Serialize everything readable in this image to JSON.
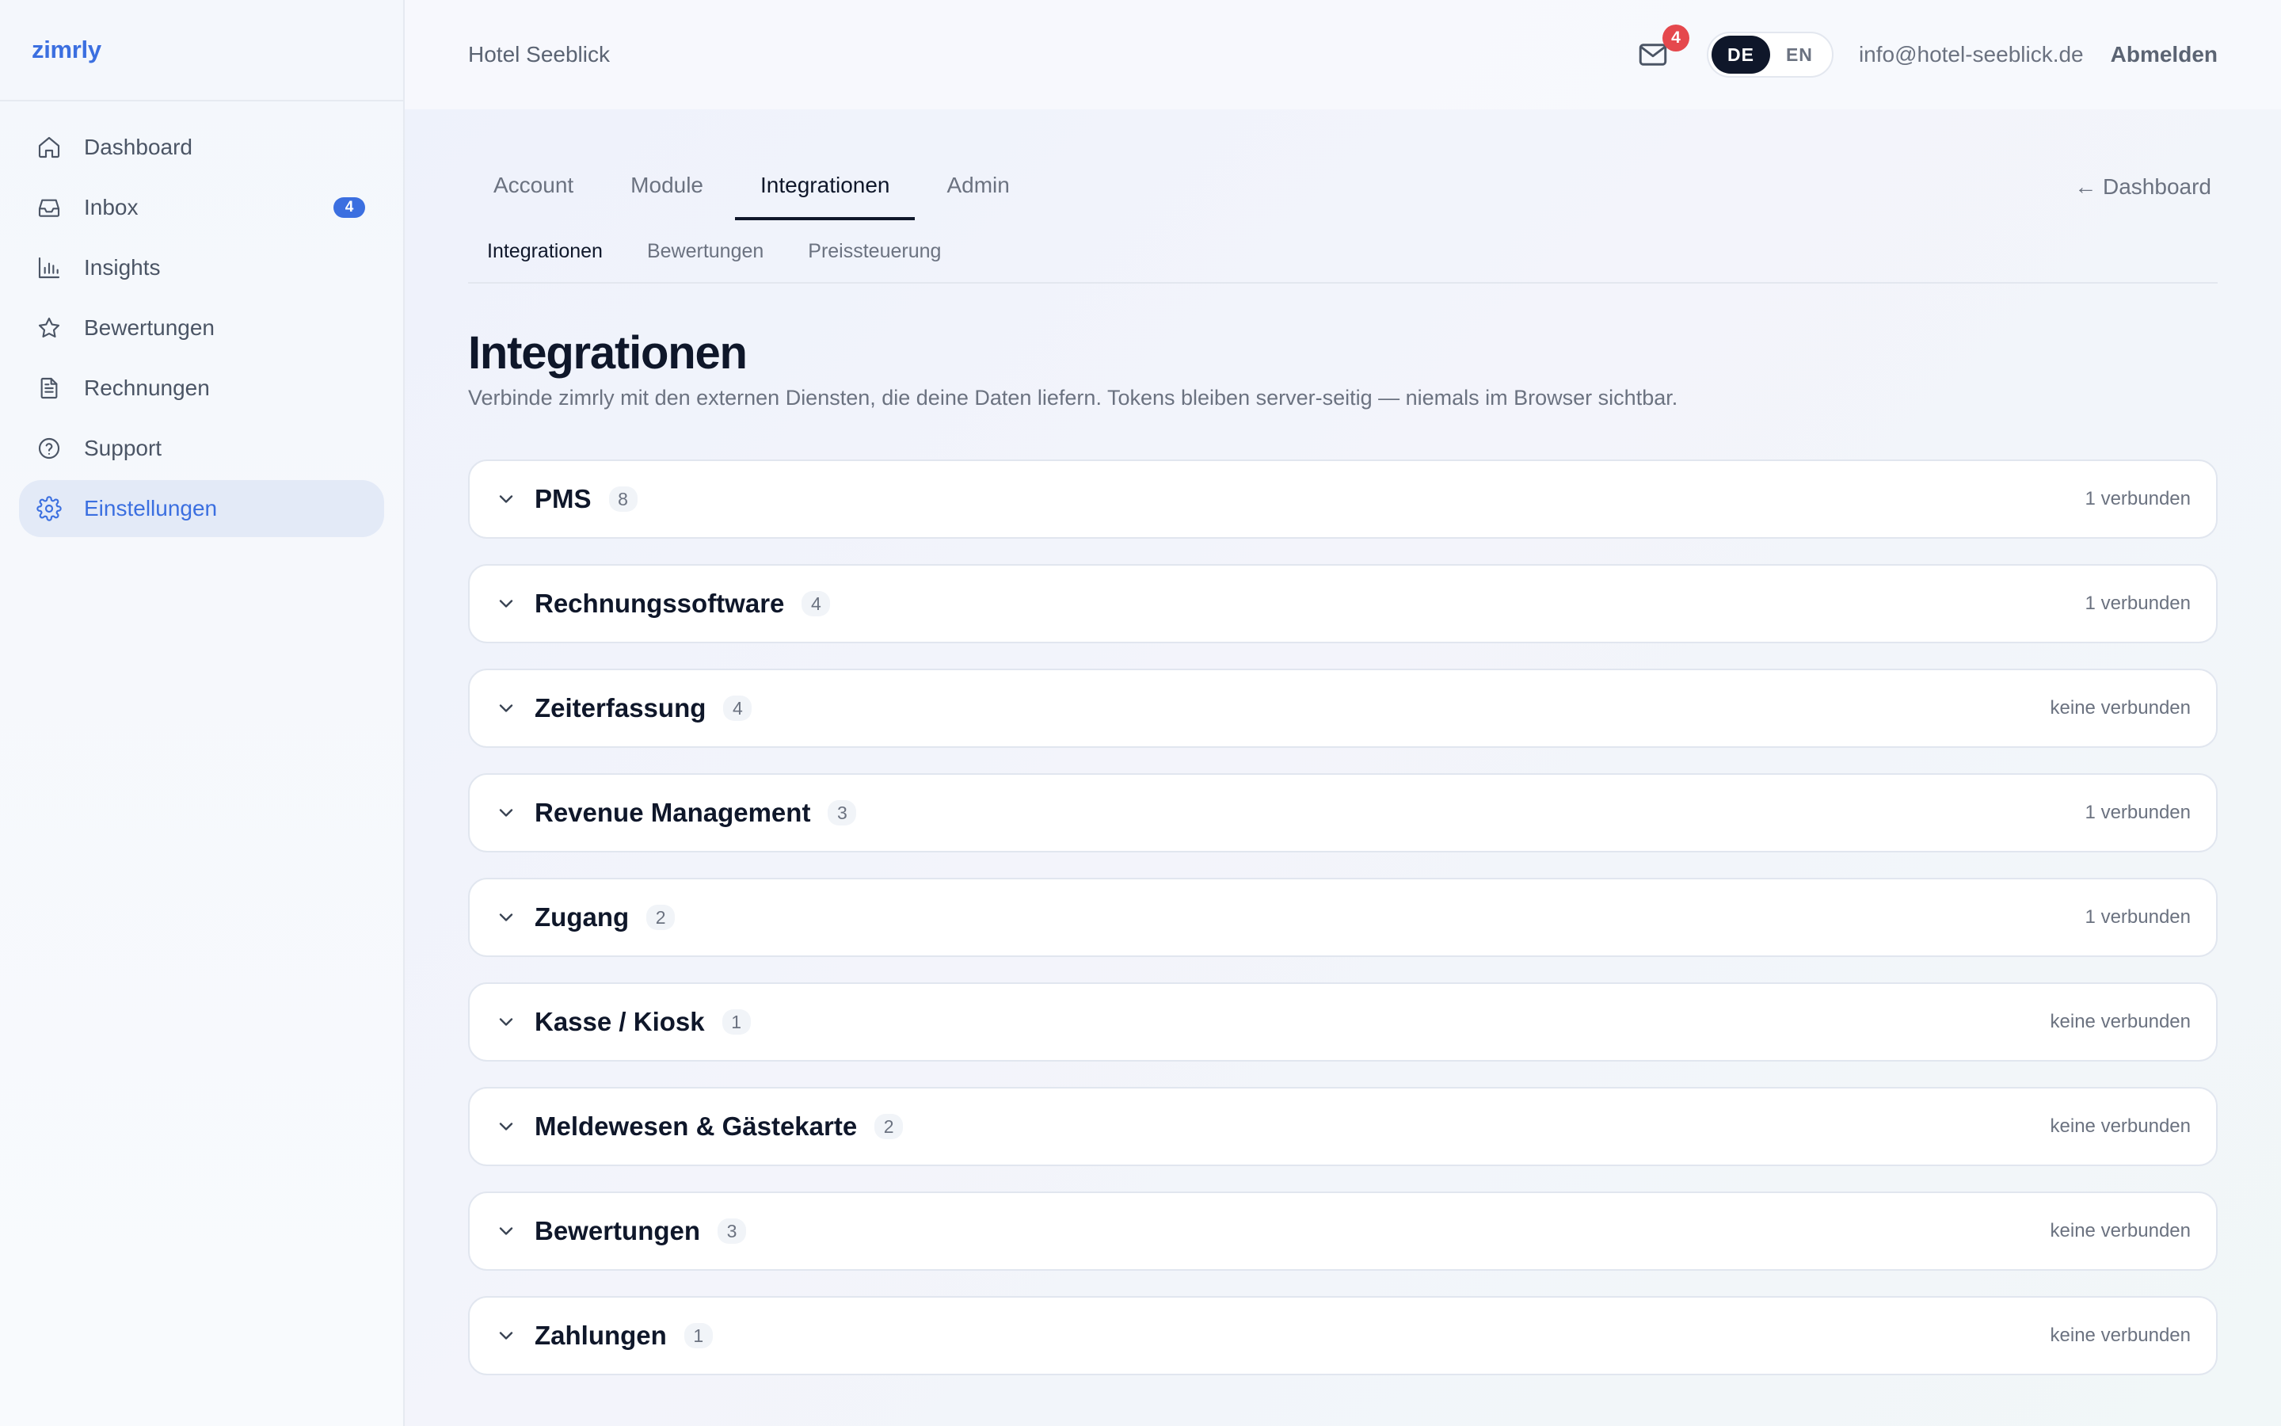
{
  "brand": "zimrly",
  "sidebar": {
    "items": [
      {
        "label": "Dashboard",
        "icon": "home-icon"
      },
      {
        "label": "Inbox",
        "icon": "inbox-icon",
        "badge": "4"
      },
      {
        "label": "Insights",
        "icon": "bar-chart-icon"
      },
      {
        "label": "Bewertungen",
        "icon": "star-icon"
      },
      {
        "label": "Rechnungen",
        "icon": "document-icon"
      },
      {
        "label": "Support",
        "icon": "help-circle-icon"
      },
      {
        "label": "Einstellungen",
        "icon": "gear-icon",
        "active": true
      }
    ]
  },
  "header": {
    "hotel": "Hotel Seeblick",
    "mail_badge": "4",
    "lang_de": "DE",
    "lang_en": "EN",
    "active_lang": "DE",
    "email": "info@hotel-seeblick.de",
    "logout": "Abmelden"
  },
  "tabs": {
    "items": [
      "Account",
      "Module",
      "Integrationen",
      "Admin"
    ],
    "active": "Integrationen",
    "back": "← Dashboard"
  },
  "subtabs": {
    "items": [
      "Integrationen",
      "Bewertungen",
      "Preissteuerung"
    ],
    "active": "Integrationen"
  },
  "page": {
    "title": "Integrationen",
    "description": "Verbinde zimrly mit den externen Diensten, die deine Daten liefern. Tokens bleiben server-seitig — niemals im Browser sichtbar."
  },
  "groups": [
    {
      "name": "PMS",
      "count": "8",
      "status": "1 verbunden"
    },
    {
      "name": "Rechnungssoftware",
      "count": "4",
      "status": "1 verbunden"
    },
    {
      "name": "Zeiterfassung",
      "count": "4",
      "status": "keine verbunden"
    },
    {
      "name": "Revenue Management",
      "count": "3",
      "status": "1 verbunden"
    },
    {
      "name": "Zugang",
      "count": "2",
      "status": "1 verbunden"
    },
    {
      "name": "Kasse / Kiosk",
      "count": "1",
      "status": "keine verbunden"
    },
    {
      "name": "Meldewesen & Gästekarte",
      "count": "2",
      "status": "keine verbunden"
    },
    {
      "name": "Bewertungen",
      "count": "3",
      "status": "keine verbunden"
    },
    {
      "name": "Zahlungen",
      "count": "1",
      "status": "keine verbunden"
    }
  ],
  "colors": {
    "accent": "#3b6fe0",
    "badge_red": "#e5484d",
    "dark": "#0f172a"
  }
}
